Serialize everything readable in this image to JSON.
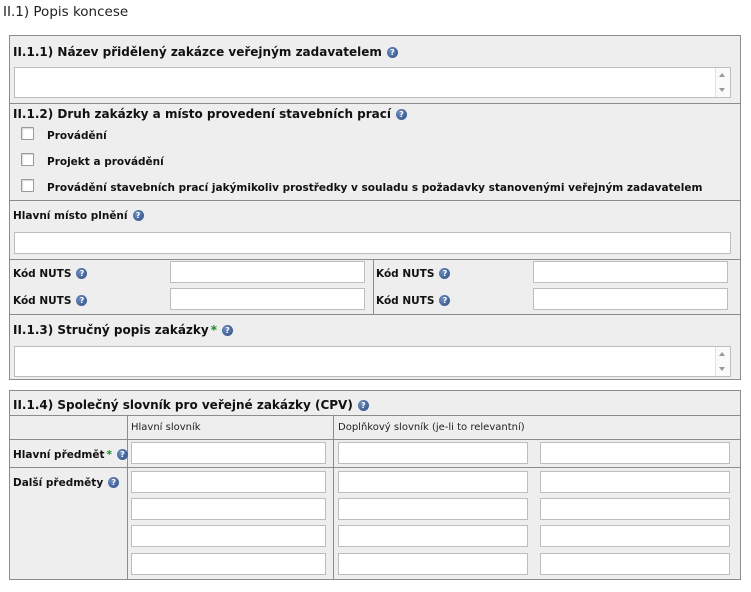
{
  "page_title": "II.1) Popis koncese",
  "icons": {
    "help": "help-icon",
    "required": "required-asterisk"
  },
  "colors": {
    "panel_bg": "#eeeeee",
    "border": "#8c8c8c",
    "help_icon": "#2a4a82",
    "required": "#1a8a1a"
  },
  "s111": {
    "heading": "II.1.1) Název přidělený zakázce veřejným zadavatelem",
    "value": ""
  },
  "s112": {
    "heading": "II.1.2) Druh zakázky a místo provedení stavebních prací",
    "options": [
      {
        "label": "Provádění",
        "checked": false
      },
      {
        "label": "Projekt a provádění",
        "checked": false
      },
      {
        "label": "Provádění stavebních prací jakýmikoliv prostředky v souladu s požadavky stanovenými veřejným zadavatelem",
        "checked": false
      }
    ],
    "main_place_label": "Hlavní místo plnění",
    "main_place_value": "",
    "nuts_label": "Kód NUTS",
    "nuts_values": [
      "",
      "",
      "",
      ""
    ]
  },
  "s113": {
    "heading": "II.1.3) Stručný popis zakázky",
    "required_mark": "*",
    "value": ""
  },
  "s114": {
    "heading": "II.1.4) Společný slovník pro veřejné zakázky (CPV)",
    "col_main": "Hlavní slovník",
    "col_supp": "Doplňkový slovník (je-li to relevantní)",
    "main_subject_label": "Hlavní předmět",
    "required_mark": "*",
    "other_subjects_label": "Další předměty"
  }
}
